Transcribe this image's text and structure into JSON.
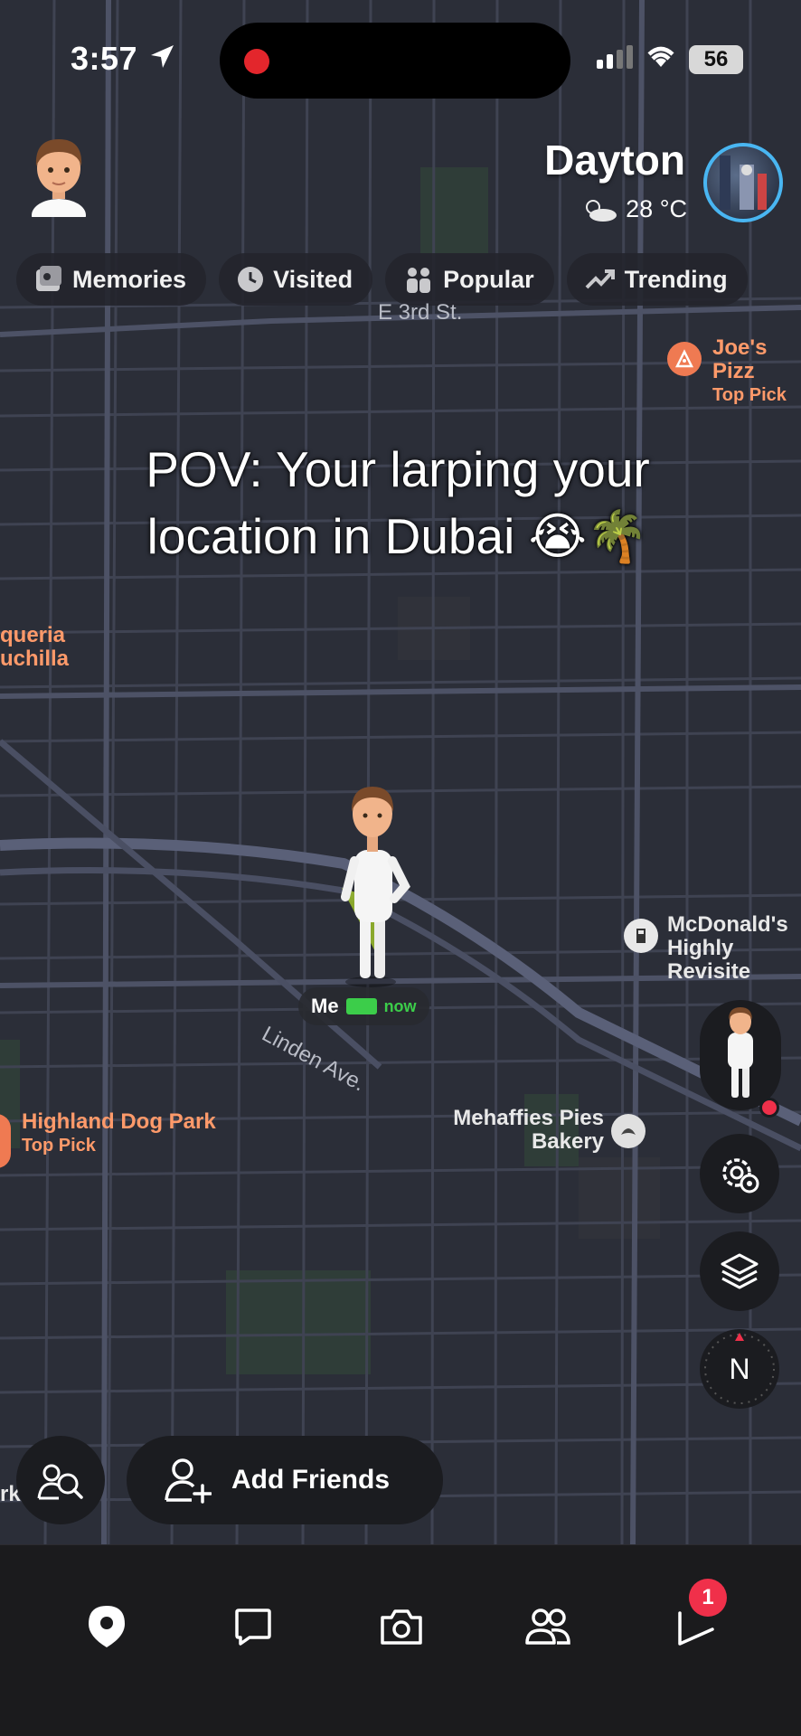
{
  "status_bar": {
    "time": "3:57",
    "battery": "56"
  },
  "header": {
    "city": "Dayton",
    "temperature": "28 °C"
  },
  "chips": [
    {
      "label": "Memories",
      "icon": "memories-icon"
    },
    {
      "label": "Visited",
      "icon": "clock-icon"
    },
    {
      "label": "Popular",
      "icon": "people-icon"
    },
    {
      "label": "Trending",
      "icon": "trending-icon"
    }
  ],
  "caption": {
    "line1": "POV: Your larping your",
    "line2": "location in Dubai 😭🌴"
  },
  "map": {
    "streets": {
      "e3rd": "E 3rd St.",
      "linden": "Linden Ave."
    },
    "places": {
      "joes": {
        "name": "Joe's Pizz",
        "sub": "Top Pick"
      },
      "taqueria": {
        "name": "queria",
        "sub": "uchilla"
      },
      "mcdonalds": {
        "name": "McDonald's",
        "sub": "Highly Revisite"
      },
      "highland": {
        "name": "Highland Dog Park",
        "sub": "Top Pick"
      },
      "mehaffies": {
        "name": "Mehaffies Pies",
        "sub": "Bakery"
      },
      "edge_k": "rk"
    },
    "me": {
      "label": "Me",
      "time": "now"
    }
  },
  "controls": {
    "compass": "N",
    "add_friends": "Add Friends"
  },
  "nav": {
    "badge_count": "1"
  },
  "colors": {
    "accent_orange": "#ff9a6a",
    "story_ring": "#49b6f2",
    "battery_green": "#3ccd4a",
    "badge_red": "#f0304a"
  }
}
